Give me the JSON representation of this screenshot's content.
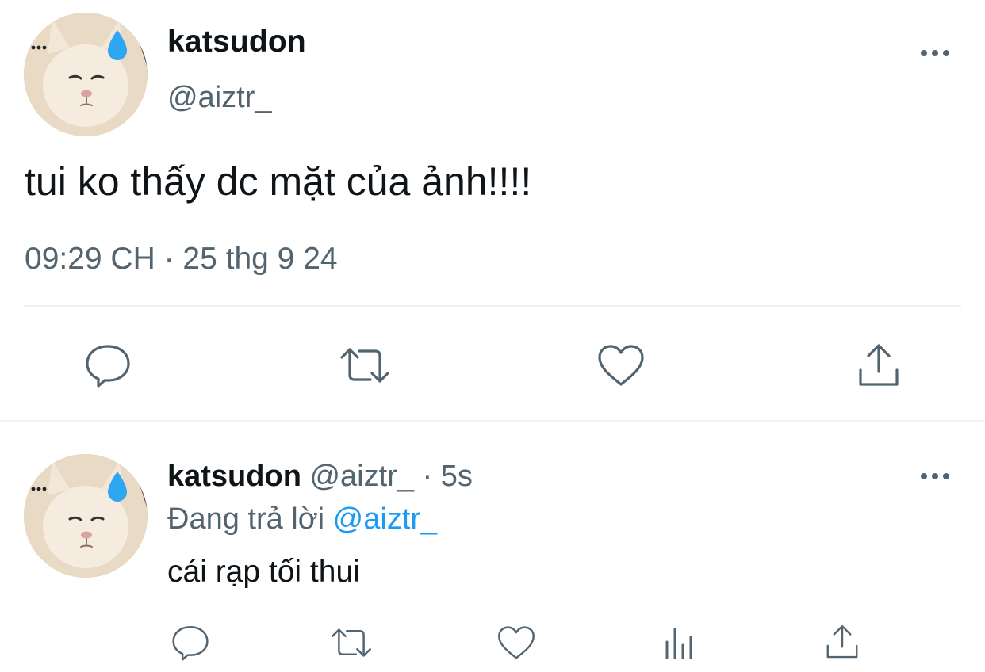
{
  "main_tweet": {
    "author_name": "katsudon",
    "author_handle": "@aiztr_",
    "text": "tui ko thấy dc mặt của ảnh!!!!",
    "timestamp": "09:29 CH · 25 thg 9 24",
    "actions": [
      "reply-icon",
      "retweet-icon",
      "like-icon",
      "share-icon"
    ]
  },
  "reply_tweet": {
    "author_name": "katsudon",
    "author_handle": "@aiztr_",
    "separator": " · ",
    "time_ago": "5s",
    "replying_prefix": "Đang trả lời ",
    "replying_to": "@aiztr_",
    "text": "cái rạp tối thui",
    "actions": [
      "reply-icon",
      "retweet-icon",
      "like-icon",
      "views-icon",
      "share-icon"
    ]
  },
  "colors": {
    "text": "#0f1419",
    "secondary": "#536471",
    "accent": "#1d9bf0",
    "divider": "#eff3f4"
  }
}
